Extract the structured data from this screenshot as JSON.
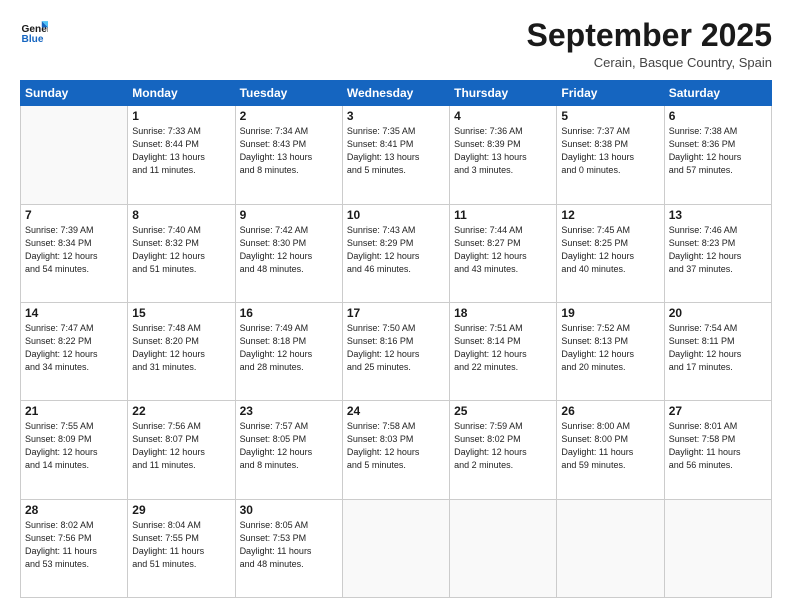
{
  "logo": {
    "line1": "General",
    "line2": "Blue"
  },
  "title": "September 2025",
  "location": "Cerain, Basque Country, Spain",
  "days_header": [
    "Sunday",
    "Monday",
    "Tuesday",
    "Wednesday",
    "Thursday",
    "Friday",
    "Saturday"
  ],
  "weeks": [
    [
      {
        "day": "",
        "info": ""
      },
      {
        "day": "1",
        "info": "Sunrise: 7:33 AM\nSunset: 8:44 PM\nDaylight: 13 hours\nand 11 minutes."
      },
      {
        "day": "2",
        "info": "Sunrise: 7:34 AM\nSunset: 8:43 PM\nDaylight: 13 hours\nand 8 minutes."
      },
      {
        "day": "3",
        "info": "Sunrise: 7:35 AM\nSunset: 8:41 PM\nDaylight: 13 hours\nand 5 minutes."
      },
      {
        "day": "4",
        "info": "Sunrise: 7:36 AM\nSunset: 8:39 PM\nDaylight: 13 hours\nand 3 minutes."
      },
      {
        "day": "5",
        "info": "Sunrise: 7:37 AM\nSunset: 8:38 PM\nDaylight: 13 hours\nand 0 minutes."
      },
      {
        "day": "6",
        "info": "Sunrise: 7:38 AM\nSunset: 8:36 PM\nDaylight: 12 hours\nand 57 minutes."
      }
    ],
    [
      {
        "day": "7",
        "info": "Sunrise: 7:39 AM\nSunset: 8:34 PM\nDaylight: 12 hours\nand 54 minutes."
      },
      {
        "day": "8",
        "info": "Sunrise: 7:40 AM\nSunset: 8:32 PM\nDaylight: 12 hours\nand 51 minutes."
      },
      {
        "day": "9",
        "info": "Sunrise: 7:42 AM\nSunset: 8:30 PM\nDaylight: 12 hours\nand 48 minutes."
      },
      {
        "day": "10",
        "info": "Sunrise: 7:43 AM\nSunset: 8:29 PM\nDaylight: 12 hours\nand 46 minutes."
      },
      {
        "day": "11",
        "info": "Sunrise: 7:44 AM\nSunset: 8:27 PM\nDaylight: 12 hours\nand 43 minutes."
      },
      {
        "day": "12",
        "info": "Sunrise: 7:45 AM\nSunset: 8:25 PM\nDaylight: 12 hours\nand 40 minutes."
      },
      {
        "day": "13",
        "info": "Sunrise: 7:46 AM\nSunset: 8:23 PM\nDaylight: 12 hours\nand 37 minutes."
      }
    ],
    [
      {
        "day": "14",
        "info": "Sunrise: 7:47 AM\nSunset: 8:22 PM\nDaylight: 12 hours\nand 34 minutes."
      },
      {
        "day": "15",
        "info": "Sunrise: 7:48 AM\nSunset: 8:20 PM\nDaylight: 12 hours\nand 31 minutes."
      },
      {
        "day": "16",
        "info": "Sunrise: 7:49 AM\nSunset: 8:18 PM\nDaylight: 12 hours\nand 28 minutes."
      },
      {
        "day": "17",
        "info": "Sunrise: 7:50 AM\nSunset: 8:16 PM\nDaylight: 12 hours\nand 25 minutes."
      },
      {
        "day": "18",
        "info": "Sunrise: 7:51 AM\nSunset: 8:14 PM\nDaylight: 12 hours\nand 22 minutes."
      },
      {
        "day": "19",
        "info": "Sunrise: 7:52 AM\nSunset: 8:13 PM\nDaylight: 12 hours\nand 20 minutes."
      },
      {
        "day": "20",
        "info": "Sunrise: 7:54 AM\nSunset: 8:11 PM\nDaylight: 12 hours\nand 17 minutes."
      }
    ],
    [
      {
        "day": "21",
        "info": "Sunrise: 7:55 AM\nSunset: 8:09 PM\nDaylight: 12 hours\nand 14 minutes."
      },
      {
        "day": "22",
        "info": "Sunrise: 7:56 AM\nSunset: 8:07 PM\nDaylight: 12 hours\nand 11 minutes."
      },
      {
        "day": "23",
        "info": "Sunrise: 7:57 AM\nSunset: 8:05 PM\nDaylight: 12 hours\nand 8 minutes."
      },
      {
        "day": "24",
        "info": "Sunrise: 7:58 AM\nSunset: 8:03 PM\nDaylight: 12 hours\nand 5 minutes."
      },
      {
        "day": "25",
        "info": "Sunrise: 7:59 AM\nSunset: 8:02 PM\nDaylight: 12 hours\nand 2 minutes."
      },
      {
        "day": "26",
        "info": "Sunrise: 8:00 AM\nSunset: 8:00 PM\nDaylight: 11 hours\nand 59 minutes."
      },
      {
        "day": "27",
        "info": "Sunrise: 8:01 AM\nSunset: 7:58 PM\nDaylight: 11 hours\nand 56 minutes."
      }
    ],
    [
      {
        "day": "28",
        "info": "Sunrise: 8:02 AM\nSunset: 7:56 PM\nDaylight: 11 hours\nand 53 minutes."
      },
      {
        "day": "29",
        "info": "Sunrise: 8:04 AM\nSunset: 7:55 PM\nDaylight: 11 hours\nand 51 minutes."
      },
      {
        "day": "30",
        "info": "Sunrise: 8:05 AM\nSunset: 7:53 PM\nDaylight: 11 hours\nand 48 minutes."
      },
      {
        "day": "",
        "info": ""
      },
      {
        "day": "",
        "info": ""
      },
      {
        "day": "",
        "info": ""
      },
      {
        "day": "",
        "info": ""
      }
    ]
  ]
}
